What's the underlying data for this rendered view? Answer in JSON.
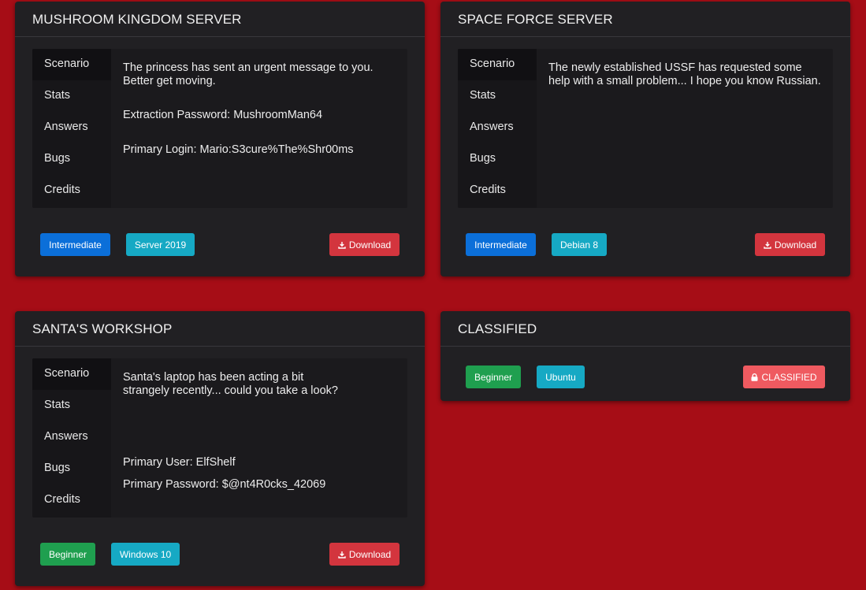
{
  "cards": [
    {
      "title": "MUSHROOM KINGDOM SERVER",
      "tabs": [
        "Scenario",
        "Stats",
        "Answers",
        "Bugs",
        "Credits"
      ],
      "scenario": {
        "description": "The princess has sent an urgent message to you. Better get moving.",
        "line1": "Extraction Password: MushroomMan64",
        "line2": "Primary Login: Mario:S3cure%The%Shr00ms"
      },
      "difficulty": "Intermediate",
      "os": "Server 2019",
      "download_label": "Download"
    },
    {
      "title": "SPACE FORCE SERVER",
      "tabs": [
        "Scenario",
        "Stats",
        "Answers",
        "Bugs",
        "Credits"
      ],
      "scenario": {
        "description": "The newly established USSF has requested some help with a small problem... I hope you know Russian."
      },
      "difficulty": "Intermediate",
      "os": "Debian 8",
      "download_label": "Download"
    },
    {
      "title": "SANTA'S WORKSHOP",
      "tabs": [
        "Scenario",
        "Stats",
        "Answers",
        "Bugs",
        "Credits"
      ],
      "scenario": {
        "description": "Santa's laptop has been acting a bit strangely recently... could you take a look?",
        "line1": "Primary User: ElfShelf",
        "line2": "Primary Password: $@nt4R0cks_42069"
      },
      "difficulty": "Beginner",
      "os": "Windows 10",
      "download_label": "Download"
    },
    {
      "title": "CLASSIFIED",
      "difficulty": "Beginner",
      "os": "Ubuntu",
      "classified_label": "CLASSIFIED"
    }
  ],
  "colors": {
    "background": "#a60d16",
    "card": "#212023",
    "intermediate": "#0b6fd9",
    "beginner": "#1f9f4f",
    "os_badge": "#16a9c4",
    "download": "#d3353e",
    "classified": "#ef5a60"
  },
  "icons": {
    "download": "download-icon",
    "classified": "lock-icon"
  }
}
